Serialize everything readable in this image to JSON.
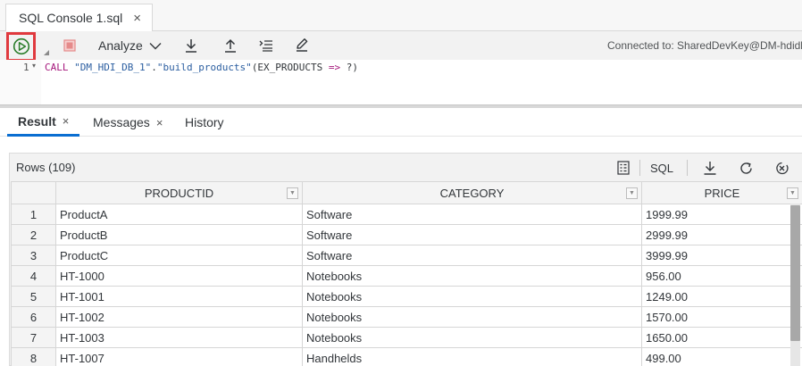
{
  "editor_tab": {
    "label": "SQL Console 1.sql",
    "close": "×"
  },
  "toolbar": {
    "run_icon": "play-circle-icon",
    "stop_icon": "stop-icon",
    "analyze_label": "Analyze",
    "connection": "Connected to: SharedDevKey@DM-hdidb"
  },
  "editor": {
    "line_number": "1",
    "code_keyword": "CALL",
    "code_schema": "\"DM_HDI_DB_1\"",
    "code_dot": ".",
    "code_proc": "\"build_products\"",
    "code_open": "(EX_PRODUCTS ",
    "code_arrow": "=>",
    "code_close": " ?)"
  },
  "result_tabs": [
    {
      "label": "Result",
      "close": "×"
    },
    {
      "label": "Messages",
      "close": "×"
    },
    {
      "label": "History"
    }
  ],
  "result": {
    "row_count": "Rows (109)",
    "sql_label": "SQL",
    "columns": [
      "PRODUCTID",
      "CATEGORY",
      "PRICE"
    ],
    "rows": [
      {
        "n": "1",
        "id": "ProductA",
        "cat": "Software",
        "price": "1999.99"
      },
      {
        "n": "2",
        "id": "ProductB",
        "cat": "Software",
        "price": "2999.99"
      },
      {
        "n": "3",
        "id": "ProductC",
        "cat": "Software",
        "price": "3999.99"
      },
      {
        "n": "4",
        "id": "HT-1000",
        "cat": "Notebooks",
        "price": "956.00"
      },
      {
        "n": "5",
        "id": "HT-1001",
        "cat": "Notebooks",
        "price": "1249.00"
      },
      {
        "n": "6",
        "id": "HT-1002",
        "cat": "Notebooks",
        "price": "1570.00"
      },
      {
        "n": "7",
        "id": "HT-1003",
        "cat": "Notebooks",
        "price": "1650.00"
      },
      {
        "n": "8",
        "id": "HT-1007",
        "cat": "Handhelds",
        "price": "499.00"
      }
    ]
  },
  "colors": {
    "accent": "#0a6ed1",
    "run_green": "#2b7d2b",
    "highlight_red": "#e0393e",
    "stop_red": "#e58a8a"
  }
}
